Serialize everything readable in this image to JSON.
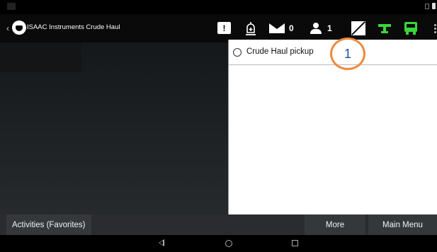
{
  "app": {
    "title": "ISAAC Instruments Crude Haul"
  },
  "header": {
    "messages_count": "0",
    "users_count": "1",
    "icons": [
      "message-alert-icon",
      "alarm-icon",
      "mail-icon",
      "person-icon",
      "diagnostic-icon",
      "tool-icon",
      "truck-icon",
      "overflow-icon"
    ],
    "accent_green": "#3ad63a"
  },
  "list": {
    "items": [
      {
        "label": "Crude Haul pickup",
        "selected": false
      }
    ]
  },
  "callout": {
    "number": "1",
    "color": "#ee8a3b"
  },
  "bottom_bar": {
    "favorites_label": "Activities (Favorites)",
    "more_label": "More",
    "main_menu_label": "Main Menu"
  }
}
